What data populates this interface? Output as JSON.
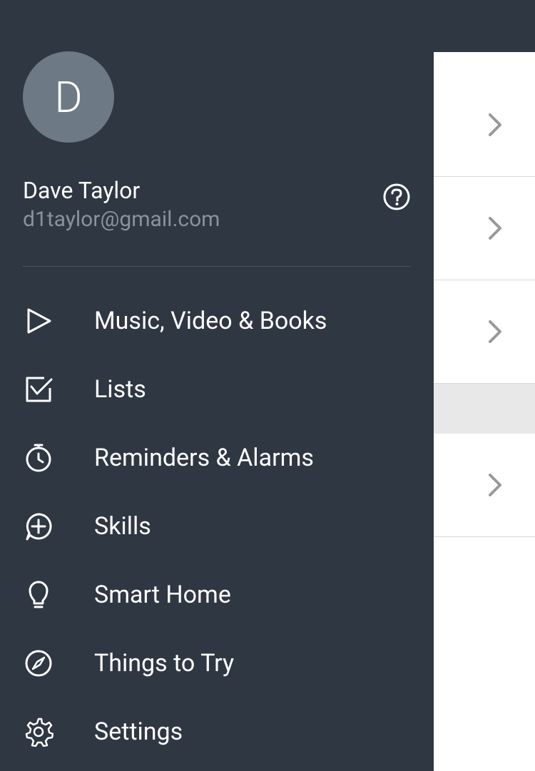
{
  "profile": {
    "avatar_initial": "D",
    "name": "Dave Taylor",
    "email": "d1taylor@gmail.com"
  },
  "menu": {
    "items": [
      {
        "label": "Music, Video & Books",
        "icon": "play"
      },
      {
        "label": "Lists",
        "icon": "checkbox"
      },
      {
        "label": "Reminders & Alarms",
        "icon": "stopwatch"
      },
      {
        "label": "Skills",
        "icon": "plus-bubble"
      },
      {
        "label": "Smart Home",
        "icon": "bulb"
      },
      {
        "label": "Things to Try",
        "icon": "compass"
      },
      {
        "label": "Settings",
        "icon": "gear"
      }
    ]
  }
}
